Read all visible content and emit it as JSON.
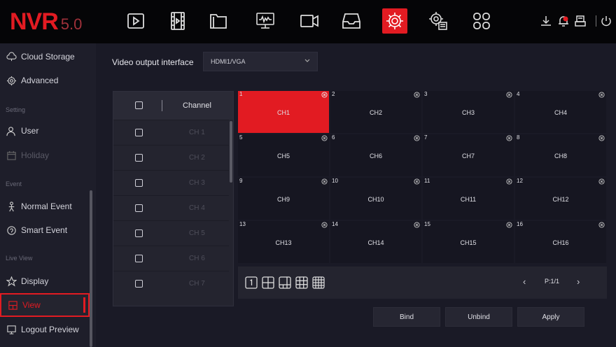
{
  "logo": {
    "brand": "NVR",
    "version": "5.0"
  },
  "topnav": {
    "icons": [
      "playback-icon",
      "video-clip-icon",
      "folder-icon",
      "monitor-waveform-icon",
      "camera-icon",
      "storage-tray-icon",
      "settings-gear-icon",
      "system-settings-icon",
      "app-grid-icon"
    ],
    "active": "settings-gear-icon",
    "right_icons": [
      "download-icon",
      "alarm-bell-icon",
      "backup-icon",
      "power-icon"
    ]
  },
  "sidebar": {
    "items": [
      {
        "label": "Cloud Storage",
        "icon": "cloud-icon"
      },
      {
        "label": "Advanced",
        "icon": "advanced-gear-icon"
      },
      {
        "label": "User",
        "icon": "user-icon"
      },
      {
        "label": "Holiday",
        "icon": "calendar-icon"
      },
      {
        "label": "Normal Event",
        "icon": "event-person-icon"
      },
      {
        "label": "Smart Event",
        "icon": "smart-event-icon"
      },
      {
        "label": "Display",
        "icon": "star-icon"
      },
      {
        "label": "View",
        "icon": "view-icon"
      },
      {
        "label": "Logout Preview",
        "icon": "logout-preview-icon"
      }
    ],
    "sections": [
      "Setting",
      "Event",
      "Live View"
    ]
  },
  "main": {
    "video_output_label": "Video output interface",
    "video_output_value": "HDMI1/VGA",
    "channel_header": "Channel",
    "channel_rows": [
      "CH 1",
      "CH 2",
      "CH 3",
      "CH 4",
      "CH 5",
      "CH 6",
      "CH 7"
    ],
    "grid": [
      {
        "num": "1",
        "name": "CH1"
      },
      {
        "num": "2",
        "name": "CH2"
      },
      {
        "num": "3",
        "name": "CH3"
      },
      {
        "num": "4",
        "name": "CH4"
      },
      {
        "num": "5",
        "name": "CH5"
      },
      {
        "num": "6",
        "name": "CH6"
      },
      {
        "num": "7",
        "name": "CH7"
      },
      {
        "num": "8",
        "name": "CH8"
      },
      {
        "num": "9",
        "name": "CH9"
      },
      {
        "num": "10",
        "name": "CH10"
      },
      {
        "num": "11",
        "name": "CH11"
      },
      {
        "num": "12",
        "name": "CH12"
      },
      {
        "num": "13",
        "name": "CH13"
      },
      {
        "num": "14",
        "name": "CH14"
      },
      {
        "num": "15",
        "name": "CH15"
      },
      {
        "num": "16",
        "name": "CH16"
      }
    ],
    "selected_cell": "1",
    "layouts": [
      "layout-1-icon",
      "layout-4-icon",
      "layout-6-icon",
      "layout-9-icon",
      "layout-16-icon"
    ],
    "pager": {
      "prev": "‹",
      "text": "P:1/1",
      "next": "›"
    },
    "buttons": {
      "bind": "Bind",
      "unbind": "Unbind",
      "apply": "Apply"
    }
  },
  "colors": {
    "accent": "#e21b22",
    "background": "#1a1a26",
    "topbar": "#050507",
    "panel": "#24242f"
  }
}
